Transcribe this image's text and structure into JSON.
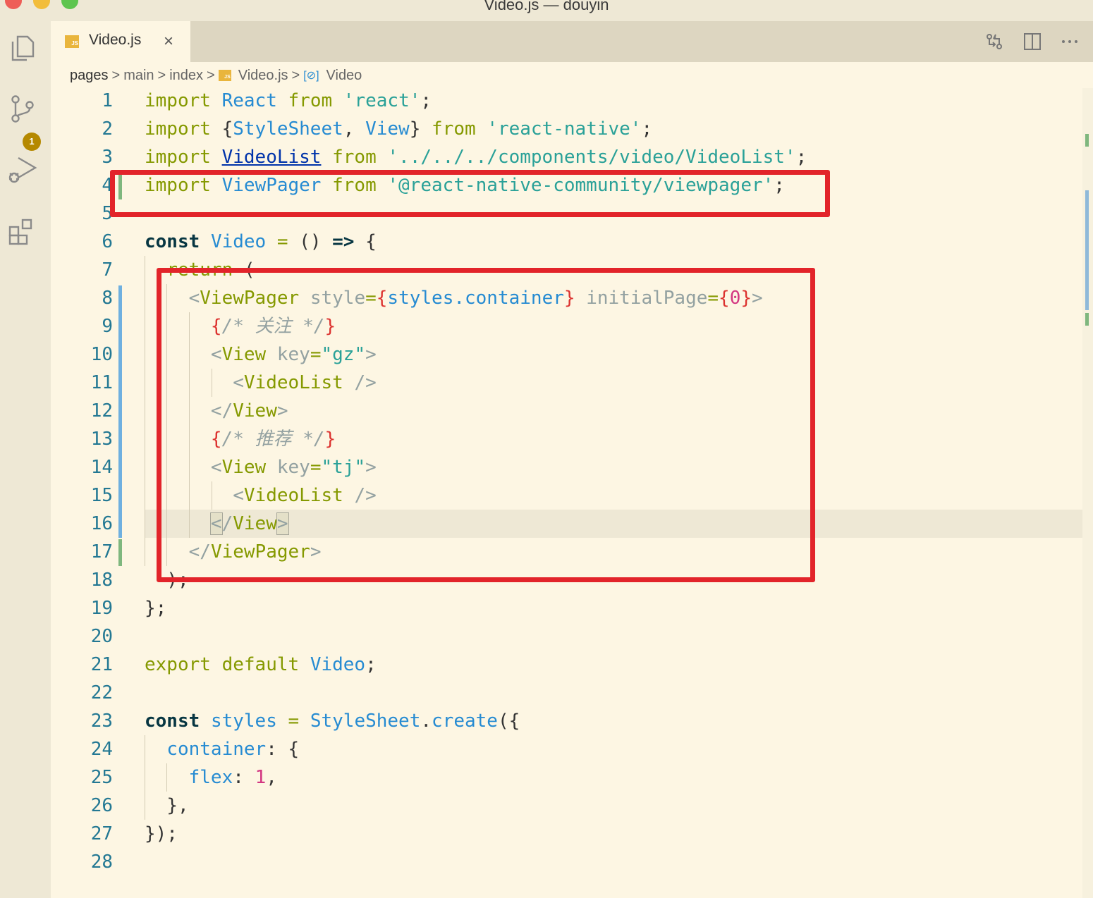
{
  "window": {
    "title": "Video.js — douyin"
  },
  "activity_bar": {
    "items": [
      "explorer-icon",
      "source-control-icon",
      "run-debug-icon",
      "extensions-icon"
    ],
    "scm_badge": "1"
  },
  "tabs": [
    {
      "file_badge": "JS",
      "label": "Video.js",
      "close": "×"
    }
  ],
  "breadcrumb": {
    "items": [
      "pages",
      "main",
      "index",
      "Video.js",
      "Video"
    ],
    "separator": ">",
    "symbol_glyph": "[⊘]"
  },
  "editor": {
    "line_numbers": [
      "1",
      "2",
      "3",
      "4",
      "5",
      "6",
      "7",
      "8",
      "9",
      "10",
      "11",
      "12",
      "13",
      "14",
      "15",
      "16",
      "17",
      "18",
      "19",
      "20",
      "21",
      "22",
      "23",
      "24",
      "25",
      "26",
      "27",
      "28"
    ],
    "tokens": {
      "import": "import",
      "from": "from",
      "react_id": "React",
      "react_str": "'react'",
      "semi": ";",
      "lbrace": "{",
      "rbrace": "}",
      "stylesheet": "StyleSheet",
      "comma_sp": ", ",
      "view": "View",
      "react_native_str": "'react-native'",
      "videolist": "VideoList",
      "videolist_path": "'../../../components/video/VideoList'",
      "viewpager": "ViewPager",
      "viewpager_path": "'@react-native-community/viewpager'",
      "const": "const",
      "video": "Video",
      "eq": "=",
      "parens": "()",
      "arrow": "=>",
      "return": "return",
      "lparen": "(",
      "rparen_semi": ");",
      "lt": "<",
      "gt": ">",
      "close_lt": "</",
      "selfclose": "/>",
      "style_attr": "style",
      "styles_container": "styles.container",
      "initialpage_attr": "initialPage",
      "zero": "0",
      "comment_follow": "/* 关注 */",
      "comment_recommend": "/* 推荐 */",
      "key_attr": "key",
      "gz_str": "\"gz\"",
      "tj_str": "\"tj\"",
      "brace_semi": "};",
      "export": "export",
      "default": "default",
      "styles": "styles",
      "create": "create",
      "paren_brace": "({",
      "dot": ".",
      "container": "container",
      "colon": ":",
      "flex": "flex",
      "one": "1",
      "comma": ",",
      "brace_comma": "},",
      "brace_paren_semi": "});"
    }
  },
  "colors": {
    "background": "#fdf6e3",
    "keyword": "#859900",
    "identifier": "#268bd2",
    "string": "#2aa198",
    "brace": "#dc322f",
    "number": "#d33682",
    "annotation_red": "#e2242a"
  }
}
